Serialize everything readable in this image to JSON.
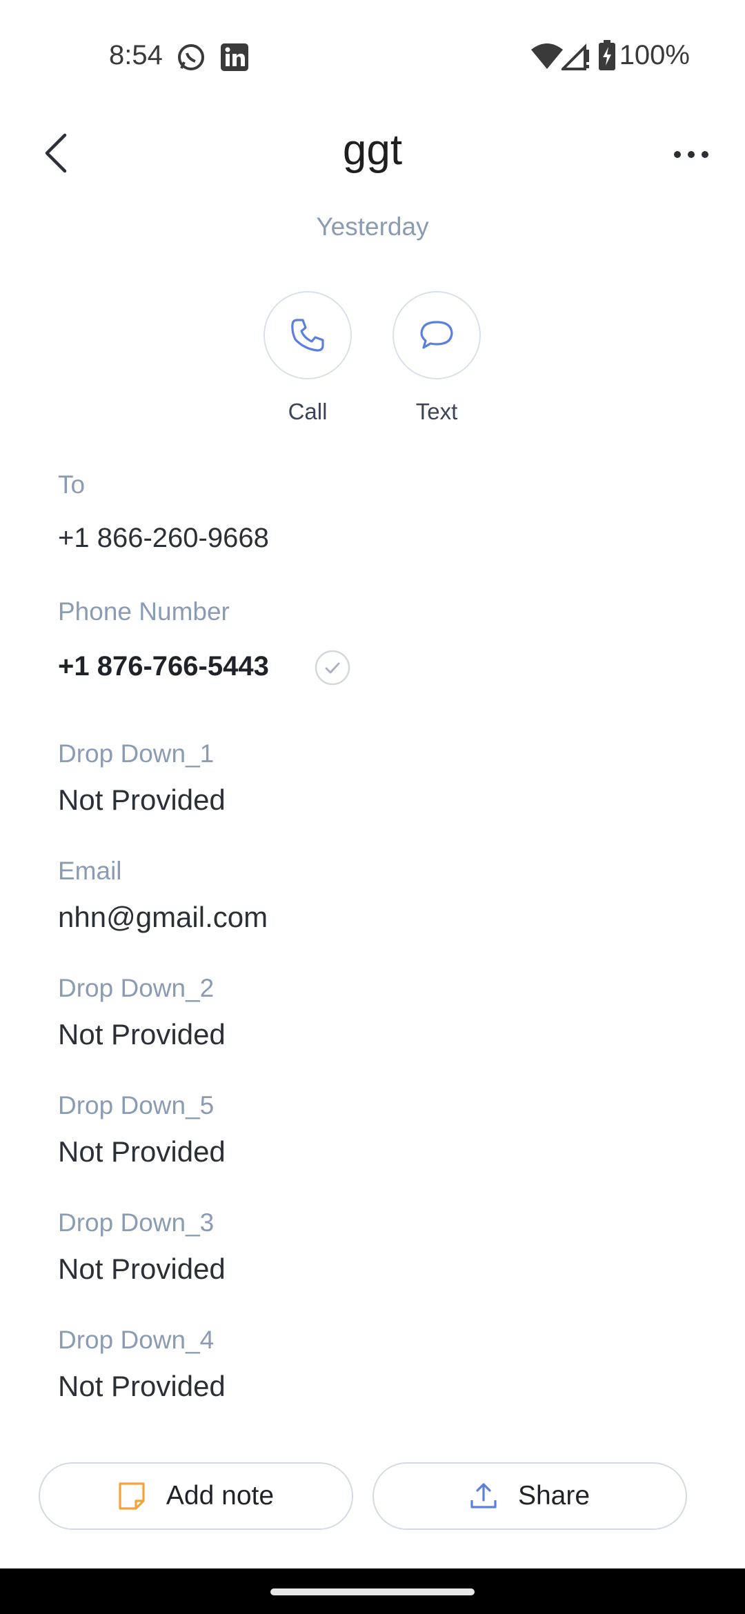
{
  "status_bar": {
    "time": "8:54",
    "battery": "100%"
  },
  "header": {
    "title": "ggt",
    "subtitle": "Yesterday"
  },
  "actions": {
    "call_label": "Call",
    "text_label": "Text"
  },
  "fields": {
    "to_label": "To",
    "to_value": "+1 866-260-9668",
    "phone_label": "Phone Number",
    "phone_value": "+1 876-766-5443",
    "dd1_label": "Drop Down_1",
    "dd1_value": "Not Provided",
    "email_label": "Email",
    "email_value": "nhn@gmail.com",
    "dd2_label": "Drop Down_2",
    "dd2_value": "Not Provided",
    "dd5_label": "Drop Down_5",
    "dd5_value": "Not Provided",
    "dd3_label": "Drop Down_3",
    "dd3_value": "Not Provided",
    "dd4_label": "Drop Down_4",
    "dd4_value": "Not Provided"
  },
  "bottom": {
    "add_note_label": "Add note",
    "share_label": "Share"
  },
  "colors": {
    "accent": "#5b7fe0",
    "muted_label": "#8a9bb3",
    "note_orange": "#f5a23a"
  },
  "icons": {
    "back": "back-arrow-icon",
    "more": "more-dots-icon",
    "call": "phone-icon",
    "text": "chat-bubble-icon",
    "verified": "check-circle-icon",
    "note": "note-icon",
    "share": "share-upload-icon"
  }
}
